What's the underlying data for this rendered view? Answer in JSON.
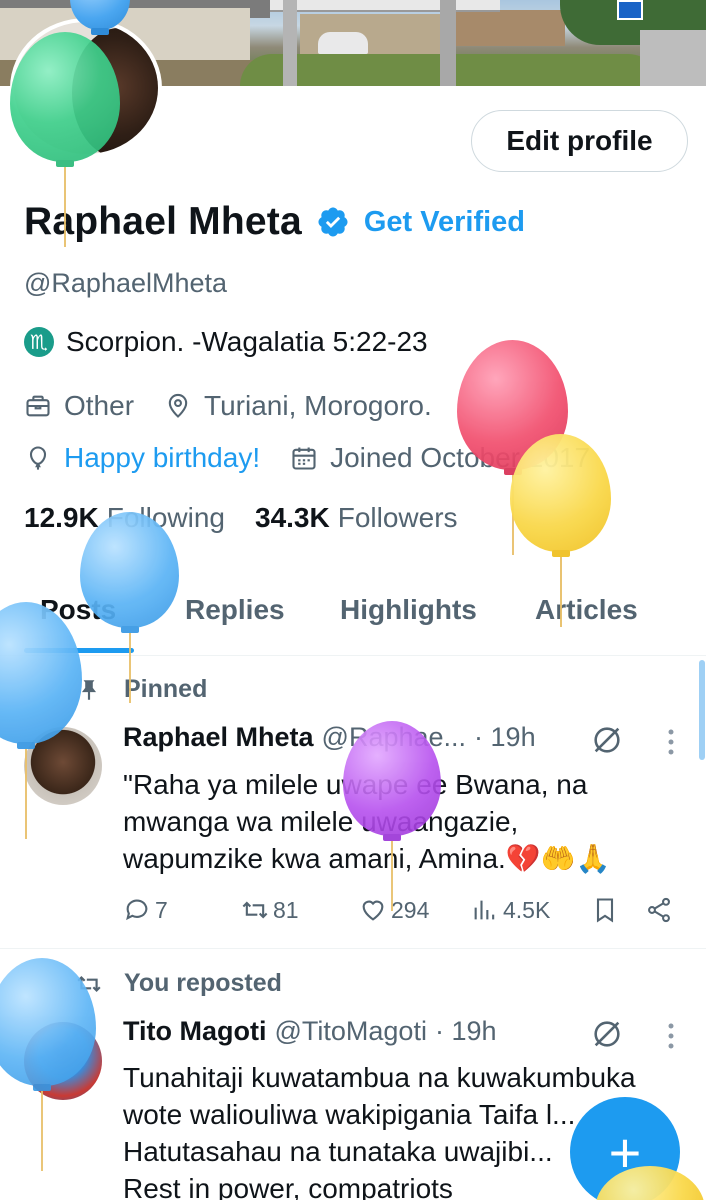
{
  "profile": {
    "name": "Raphael Mheta",
    "get_verified": "Get Verified",
    "handle": "@RaphaelMheta",
    "bio": "Scorpion. -Wagalatia 5:22-23",
    "bio_icon": "scorpio-zodiac-icon",
    "category": "Other",
    "location": "Turiani, Morogoro.",
    "birthday": "Happy birthday!",
    "joined": "Joined October 2017",
    "edit_profile": "Edit profile",
    "following_count": "12.9K",
    "following_label": "Following",
    "followers_count": "34.3K",
    "followers_label": "Followers"
  },
  "tabs": [
    {
      "label": "Posts",
      "active": true
    },
    {
      "label": "Replies",
      "active": false
    },
    {
      "label": "Highlights",
      "active": false
    },
    {
      "label": "Articles",
      "active": false
    }
  ],
  "posts": [
    {
      "context": "Pinned",
      "author": "Raphael Mheta",
      "handle": "@Raphae...",
      "time": "· 19h",
      "text_lines": [
        "\"Raha ya milele uwape ee Bwana, na",
        "mwanga wa milele uwaangazie,",
        "wapumzike kwa amani, Amina.💔🤲🙏"
      ],
      "replies": "7",
      "reposts": "81",
      "likes": "294",
      "views": "4.5K"
    },
    {
      "context": "You reposted",
      "author": "Tito Magoti",
      "handle": "@TitoMagoti",
      "time": "· 19h",
      "text_lines": [
        "Tunahitaji kuwatambua na kuwakumbuka",
        "wote waliouliwa wakipigania Taifa l...",
        "Hatutasahau na tunataka uwajibi...",
        "Rest in power, compatriots"
      ]
    }
  ],
  "fab": "+",
  "colors": {
    "accent": "#1d9bf0",
    "text": "#0f1419",
    "muted": "#536471",
    "border": "#cfd9de"
  }
}
